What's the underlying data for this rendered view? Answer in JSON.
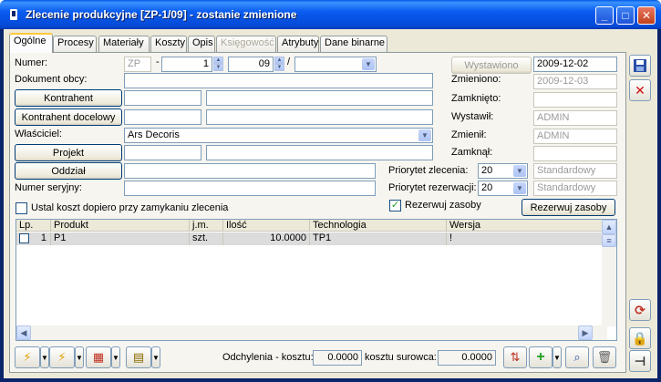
{
  "window": {
    "title": "Zlecenie produkcyjne  [ZP-1/09] - zostanie zmienione",
    "min_icon": "minimize-icon",
    "max_icon": "maximize-icon",
    "close_icon": "close-icon",
    "min_glyph": "_",
    "max_glyph": "□",
    "close_glyph": "✕"
  },
  "tabs": [
    {
      "label": "Ogólne",
      "active": true
    },
    {
      "label": "Procesy"
    },
    {
      "label": "Materiały"
    },
    {
      "label": "Koszty"
    },
    {
      "label": "Opis"
    },
    {
      "label": "Księgowość",
      "disabled": true
    },
    {
      "label": "Atrybuty"
    },
    {
      "label": "Dane binarne"
    }
  ],
  "form": {
    "numer_label": "Numer:",
    "numer_prefix": "ZP",
    "numer_sep1": "-",
    "numer_value": "1",
    "numer_year": "09",
    "numer_sep2": "/",
    "numer_series": "",
    "dokument_obcy_label": "Dokument obcy:",
    "dokument_obcy_value": "",
    "kontrahent_button": "Kontrahent",
    "kontrahent_code": "",
    "kontrahent_name": "",
    "kontrahent_docelowy_button": "Kontrahent docelowy",
    "kontrahent_docelowy_code": "",
    "kontrahent_docelowy_name": "",
    "wlasciciel_label": "Właściciel:",
    "wlasciciel_value": "Ars Decoris",
    "projekt_button": "Projekt",
    "projekt_code": "",
    "projekt_name": "",
    "oddzial_button": "Oddział",
    "oddzial_value": "",
    "numer_seryjny_label": "Numer seryjny:",
    "numer_seryjny_value": "",
    "ustal_koszt_label": "Ustal koszt dopiero przy zamykaniu zlecenia",
    "ustal_koszt_checked": false,
    "wystawiono_button": "Wystawiono",
    "wystawiono_date": "2009-12-02",
    "zmieniono_label": "Zmieniono:",
    "zmieniono_date": "2009-12-03",
    "zamknieto_label": "Zamknięto:",
    "zamknieto_value": "",
    "wystawil_label": "Wystawił:",
    "wystawil_value": "ADMIN",
    "zmienil_label": "Zmienił:",
    "zmienil_value": "ADMIN",
    "zamknal_label": "Zamknął:",
    "zamknal_value": "",
    "priorytet_zlecenia_label": "Priorytet zlecenia:",
    "priorytet_zlecenia_value": "20",
    "priorytet_zlecenia_desc": "Standardowy",
    "priorytet_rezerwacji_label": "Priorytet rezerwacji:",
    "priorytet_rezerwacji_value": "20",
    "priorytet_rezerwacji_desc": "Standardowy",
    "rezerwuj_checkbox_label": "Rezerwuj zasoby",
    "rezerwuj_checked": true,
    "rezerwuj_button": "Rezerwuj zasoby"
  },
  "grid": {
    "columns": [
      "Lp.",
      "Produkt",
      "j.m.",
      "Ilość",
      "Technologia",
      "Wersja"
    ],
    "rows": [
      {
        "lp": "1",
        "produkt": "P1",
        "jm": "szt.",
        "ilosc": "10.0000",
        "technologia": "TP1",
        "wersja": "!"
      }
    ]
  },
  "footer": {
    "odchylenia_label": "Odchylenia - kosztu:",
    "odchylenia_value": "0.0000",
    "surowca_label": "kosztu surowca:",
    "surowca_value": "0.0000"
  },
  "icons": {
    "save": "save-icon",
    "cancel": "cancel-icon",
    "refresh": "refresh-icon",
    "lock": "lock-icon",
    "pin": "pin-icon",
    "lightning": "lightning-icon",
    "lightning_double": "double-lightning-icon",
    "calculator": "calculator-icon",
    "document": "document-icon",
    "transfer": "transfer-icon",
    "add": "add-icon",
    "search": "search-icon",
    "trash": "trash-icon"
  },
  "colors": {
    "title_bar": "#0449d6",
    "form_bg": "#ece9d8",
    "selected_row": "#dcdcdc"
  }
}
